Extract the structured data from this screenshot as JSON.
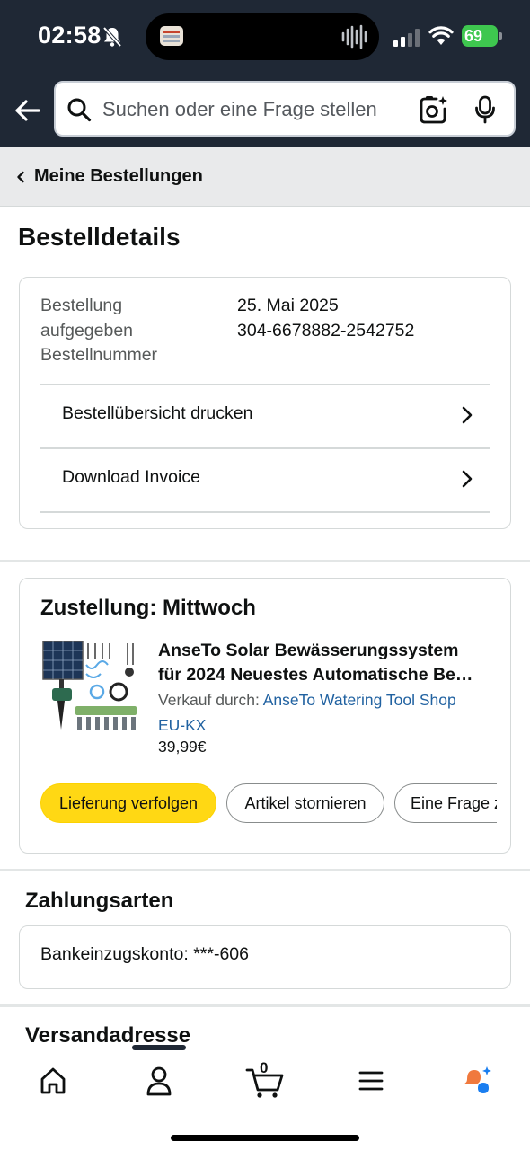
{
  "status_bar": {
    "time": "02:58",
    "battery": "69"
  },
  "search": {
    "placeholder": "Suchen oder eine Frage stellen"
  },
  "breadcrumb": {
    "label": "Meine Bestellungen"
  },
  "page": {
    "title": "Bestelldetails"
  },
  "order_summary": {
    "label_lines": [
      "Bestellung",
      "aufgegeben",
      "Bestellnummer"
    ],
    "order_date": "25. Mai 2025",
    "order_number": "304-6678882-2542752",
    "links": [
      {
        "label": "Bestellübersicht drucken"
      },
      {
        "label": "Download Invoice"
      }
    ]
  },
  "shipment": {
    "title": "Zustellung: Mittwoch",
    "product": {
      "title_line1": "AnseTo Solar Bewässerungssystem",
      "title_line2": "für 2024 Neuestes Automatische Be…",
      "seller_prefix": "Verkauf durch: ",
      "seller_name_line1": "AnseTo Watering Tool Shop",
      "seller_name_line2": "EU-KX",
      "price": "39,99€"
    },
    "buttons": {
      "track": "Lieferung verfolgen",
      "cancel": "Artikel stornieren",
      "ask": "Eine Frage z"
    }
  },
  "payment": {
    "title": "Zahlungsarten",
    "method": "Bankeinzugskonto: ***-606"
  },
  "address": {
    "title": "Versandadresse"
  },
  "bottom_nav": {
    "items": [
      "home-icon",
      "account-icon",
      "cart-icon",
      "menu-icon",
      "rufus-icon"
    ],
    "cart_count": "0"
  },
  "colors": {
    "header_bg": "#1f2835",
    "primary_button": "#ffd814",
    "link": "#2162a1",
    "battery": "#3ec74f"
  }
}
